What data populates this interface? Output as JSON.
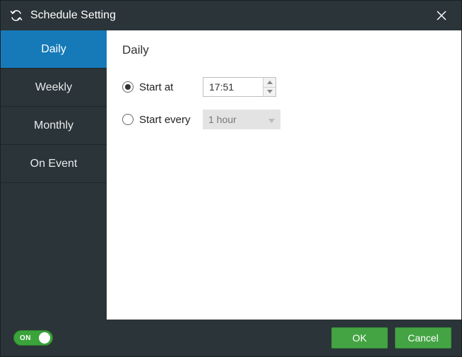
{
  "window": {
    "title": "Schedule Setting"
  },
  "sidebar": {
    "items": [
      {
        "label": "Daily",
        "active": true
      },
      {
        "label": "Weekly",
        "active": false
      },
      {
        "label": "Monthly",
        "active": false
      },
      {
        "label": "On Event",
        "active": false
      }
    ]
  },
  "content": {
    "title": "Daily",
    "start_at": {
      "label": "Start at",
      "selected": true,
      "value": "17:51"
    },
    "start_every": {
      "label": "Start every",
      "selected": false,
      "value": "1 hour"
    }
  },
  "footer": {
    "toggle": {
      "on": true,
      "label": "ON"
    },
    "ok": "OK",
    "cancel": "Cancel"
  }
}
